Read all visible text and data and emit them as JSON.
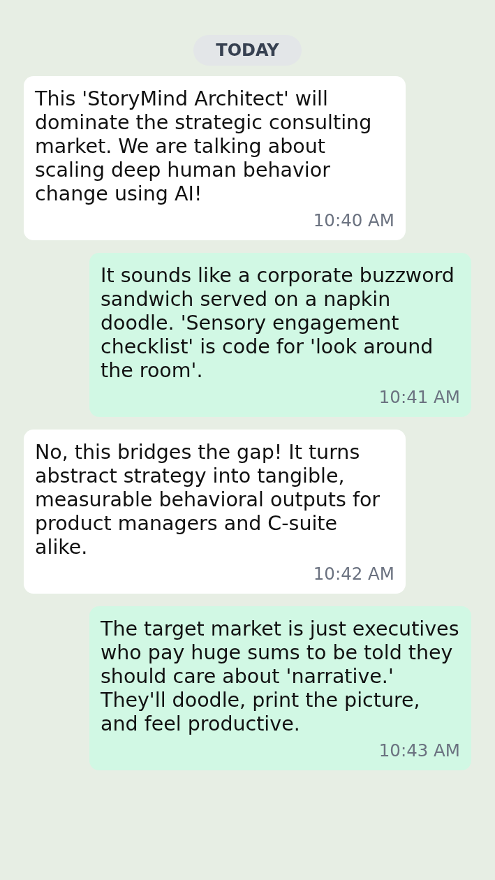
{
  "date_divider": "TODAY",
  "messages": [
    {
      "kind": "incoming",
      "text": "This 'StoryMind Architect' will dominate the strategic consulting market. We are talking about scaling deep human behavior change using AI!",
      "time": "10:40 AM"
    },
    {
      "kind": "outgoing",
      "text": "It sounds like a corporate buzzword sandwich served on a napkin doodle. 'Sensory engagement checklist' is code for 'look around the room'.",
      "time": "10:41 AM"
    },
    {
      "kind": "incoming",
      "text": "No, this bridges the gap! It turns abstract strategy into tangible, measurable behavioral outputs for product managers and C-suite alike.",
      "time": "10:42 AM"
    },
    {
      "kind": "outgoing",
      "text": "The target market is just executives who pay huge sums to be told they should care about 'narrative.' They'll doodle, print the picture, and feel productive.",
      "time": "10:43 AM"
    }
  ]
}
